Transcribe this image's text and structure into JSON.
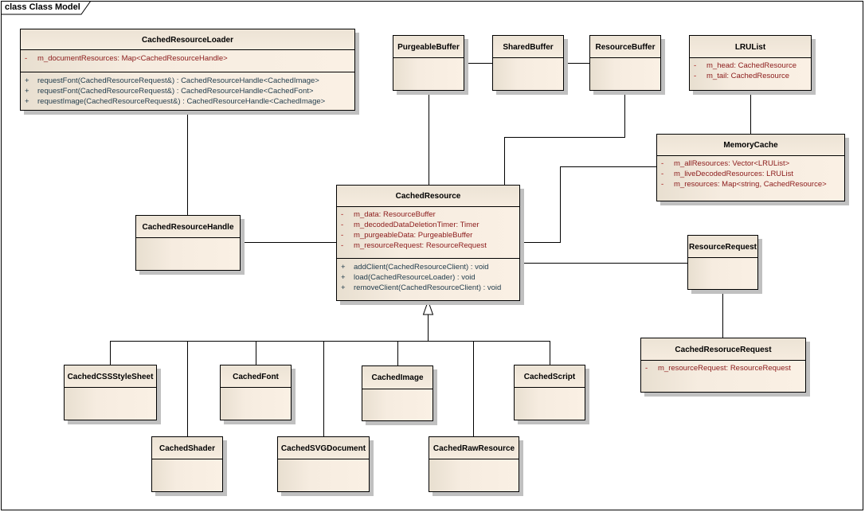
{
  "frame": {
    "title": "class Class Model"
  },
  "classes": {
    "loader": {
      "name": "CachedResourceLoader",
      "attributes": [
        {
          "vis": "-",
          "text": "m_documentResources:  Map<CachedResourceHandle>"
        }
      ],
      "operations": [
        {
          "vis": "+",
          "text": "requestFont(CachedResourceRequest&) : CachedResourceHandle<CachedImage>"
        },
        {
          "vis": "+",
          "text": "requestFont(CachedResourceRequest&) : CachedResourceHandle<CachedFont>"
        },
        {
          "vis": "+",
          "text": "requestImage(CachedResourceRequest&) : CachedResourceHandle<CachedImage>"
        }
      ]
    },
    "purgeable": {
      "name": "PurgeableBuffer"
    },
    "shared": {
      "name": "SharedBuffer"
    },
    "resbuf": {
      "name": "ResourceBuffer"
    },
    "lrulist": {
      "name": "LRUList",
      "attributes": [
        {
          "vis": "-",
          "text": "m_head:  CachedResource"
        },
        {
          "vis": "-",
          "text": "m_tail:  CachedResource"
        }
      ]
    },
    "memcache": {
      "name": "MemoryCache",
      "attributes": [
        {
          "vis": "-",
          "text": "m_allResources:  Vector<LRUList>"
        },
        {
          "vis": "-",
          "text": "m_liveDecodedResources:  LRUList"
        },
        {
          "vis": "-",
          "text": "m_resources:  Map<string, CachedResource>"
        }
      ]
    },
    "handle": {
      "name": "CachedResourceHandle"
    },
    "resource": {
      "name": "CachedResource",
      "attributes": [
        {
          "vis": "-",
          "text": "m_data:  ResourceBuffer"
        },
        {
          "vis": "-",
          "text": "m_decodedDataDeletionTimer:  Timer"
        },
        {
          "vis": "-",
          "text": "m_purgeableData:  PurgeableBuffer"
        },
        {
          "vis": "-",
          "text": "m_resourceRequest:  ResourceRequest"
        }
      ],
      "operations": [
        {
          "vis": "+",
          "text": "addClient(CachedResourceClient) : void"
        },
        {
          "vis": "+",
          "text": "load(CachedResourceLoader) : void"
        },
        {
          "vis": "+",
          "text": "removeClient(CachedResourceClient) : void"
        }
      ]
    },
    "resrequest": {
      "name": "ResourceRequest"
    },
    "cachedreq": {
      "name": "CachedResoruceRequest",
      "attributes": [
        {
          "vis": "-",
          "text": "m_resourceRequest:  ResourceRequest"
        }
      ]
    },
    "css": {
      "name": "CachedCSSStyleSheet"
    },
    "font": {
      "name": "CachedFont"
    },
    "image": {
      "name": "CachedImage"
    },
    "script": {
      "name": "CachedScript"
    },
    "shader": {
      "name": "CachedShader"
    },
    "svg": {
      "name": "CachedSVGDocument"
    },
    "raw": {
      "name": "CachedRawResource"
    }
  }
}
